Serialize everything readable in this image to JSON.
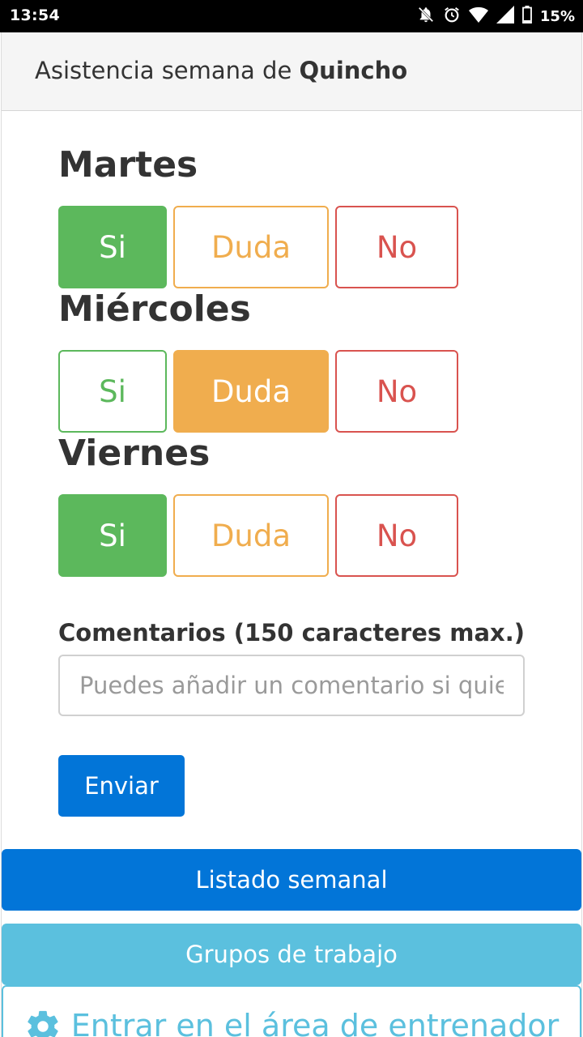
{
  "status_bar": {
    "time": "13:54",
    "battery": "15%",
    "icons": [
      "notifications-off-icon",
      "alarm-icon",
      "wifi-icon",
      "cell-signal-icon",
      "battery-icon"
    ]
  },
  "header": {
    "title_prefix": "Asistencia semana de ",
    "title_name": "Quincho"
  },
  "days": [
    {
      "label": "Martes",
      "options": [
        "Si",
        "Duda",
        "No"
      ],
      "selected": "Si"
    },
    {
      "label": "Miércoles",
      "options": [
        "Si",
        "Duda",
        "No"
      ],
      "selected": "Duda"
    },
    {
      "label": "Viernes",
      "options": [
        "Si",
        "Duda",
        "No"
      ],
      "selected": "Si"
    }
  ],
  "comments": {
    "label": "Comentarios (150 caracteres max.)",
    "placeholder": "Puedes añadir un comentario si quieres",
    "value": ""
  },
  "actions": {
    "submit": "Enviar",
    "weekly_list": "Listado semanal",
    "work_groups": "Grupos de trabajo",
    "coach_area": "Entrar en el área de entrenador"
  },
  "colors": {
    "si": "#5cb85c",
    "duda": "#f0ad4e",
    "no": "#d9534f",
    "primary": "#0275d8",
    "info": "#5bc0de"
  }
}
